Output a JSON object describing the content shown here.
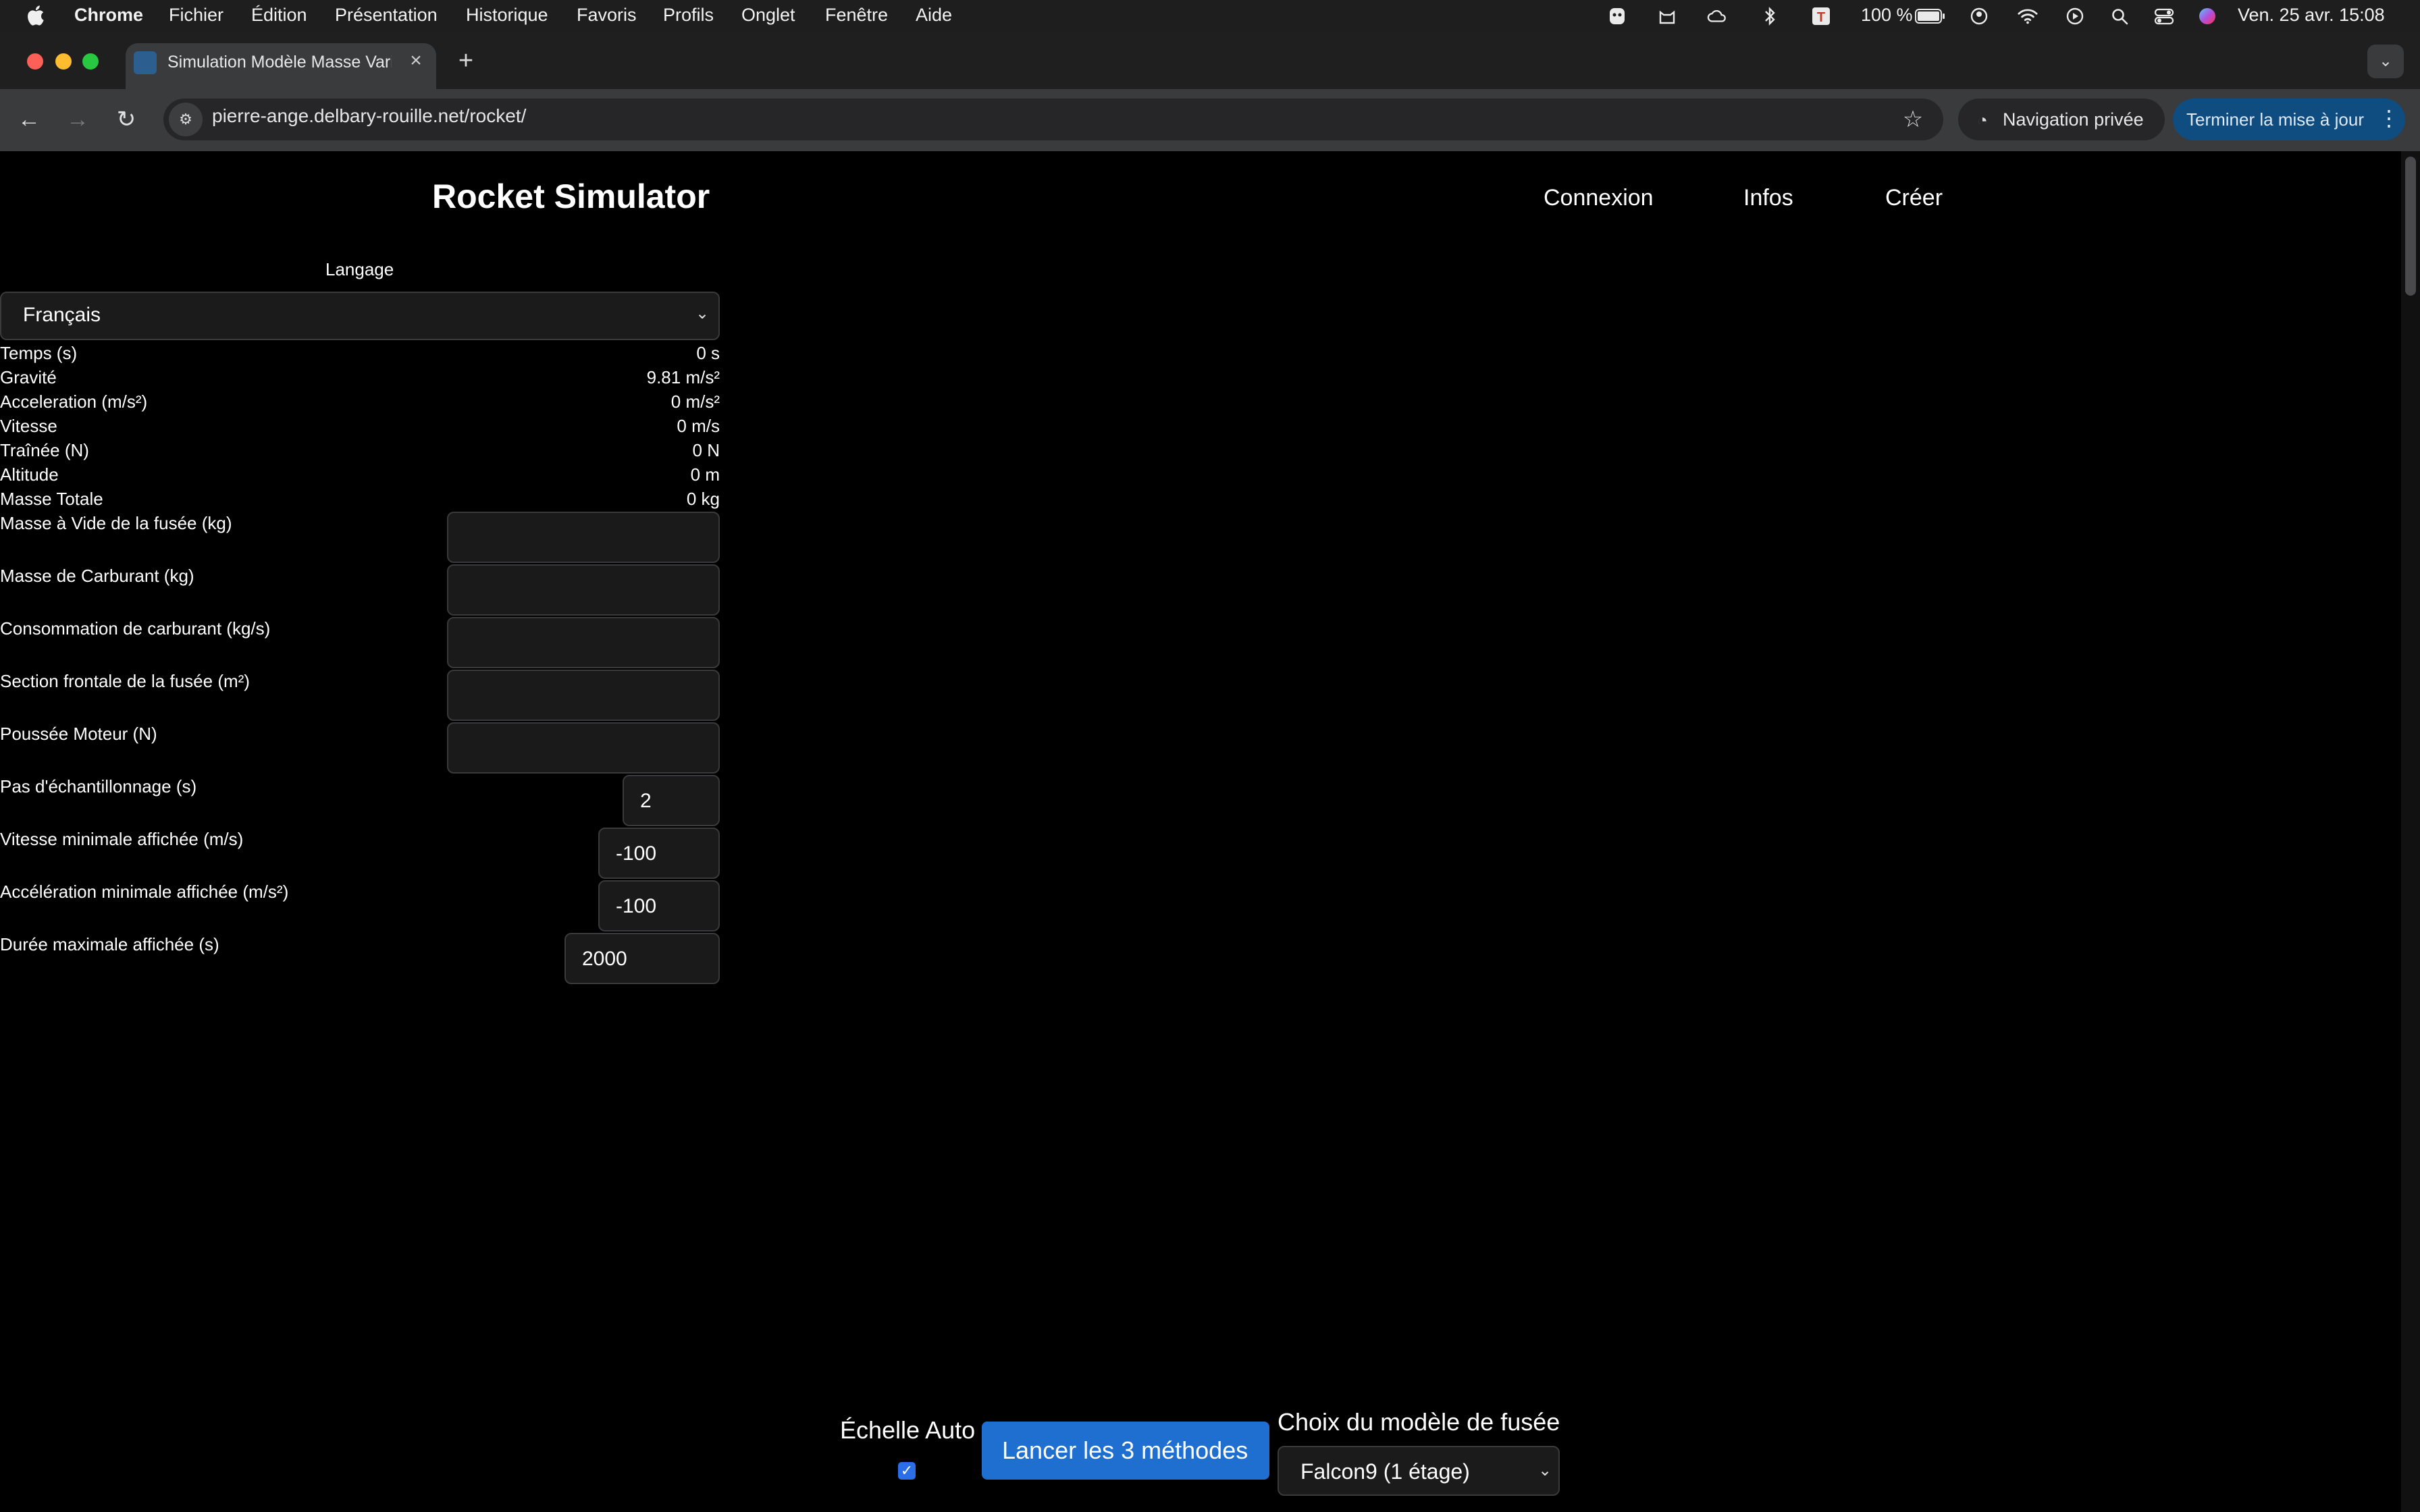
{
  "menubar": {
    "app": "Chrome",
    "items": [
      "Fichier",
      "Édition",
      "Présentation",
      "Historique",
      "Favoris",
      "Profils",
      "Onglet",
      "Fenêtre",
      "Aide"
    ],
    "battery": "100 %",
    "datetime": "Ven. 25 avr.  15:08"
  },
  "browser": {
    "tab_title": "Simulation Modèle Masse Variable",
    "url_host": "pierre-ange.delbary-rouille.net",
    "url_path": "/rocket/",
    "incognito_label": "Navigation privée",
    "update_label": "Terminer la mise à jour"
  },
  "header": {
    "title": "Rocket Simulator",
    "nav": [
      "Connexion",
      "Infos",
      "Créer"
    ]
  },
  "language": {
    "label": "Langage",
    "selected": "Français"
  },
  "readouts": [
    {
      "label": "Temps (s)",
      "value": "0 s"
    },
    {
      "label": "Gravité",
      "value": "9.81 m/s²"
    },
    {
      "label": "Acceleration (m/s²)",
      "value": "0 m/s²"
    },
    {
      "label": "Vitesse",
      "value": "0 m/s"
    },
    {
      "label": "Traînée (N)",
      "value": "0 N"
    },
    {
      "label": "Altitude",
      "value": "0 m"
    },
    {
      "label": "Masse Totale",
      "value": "0 kg"
    }
  ],
  "inputs": [
    {
      "label": "Masse à Vide de la fusée (kg)",
      "value": ""
    },
    {
      "label": "Masse de Carburant (kg)",
      "value": ""
    },
    {
      "label": "Consommation de carburant (kg/s)",
      "value": ""
    },
    {
      "label": "Section frontale de la fusée (m²)",
      "value": ""
    },
    {
      "label": "Poussée Moteur (N)",
      "value": ""
    },
    {
      "label": "Pas d'échantillonnage (s)",
      "value": "2"
    },
    {
      "label": "Vitesse minimale affichée (m/s)",
      "value": "-100"
    },
    {
      "label": "Accélération minimale affichée (m/s²)",
      "value": "-100"
    },
    {
      "label": "Durée maximale affichée (s)",
      "value": "2000"
    }
  ],
  "controls": {
    "auto_scale_label": "Échelle Auto",
    "auto_scale_checked": true,
    "run_label": "Lancer les 3 méthodes",
    "model_label": "Choix du modèle de fusée",
    "model_selected": "Falcon9 (1 étage)"
  },
  "colors": {
    "accent": "#1f6fd1",
    "page_bg": "#000000"
  }
}
